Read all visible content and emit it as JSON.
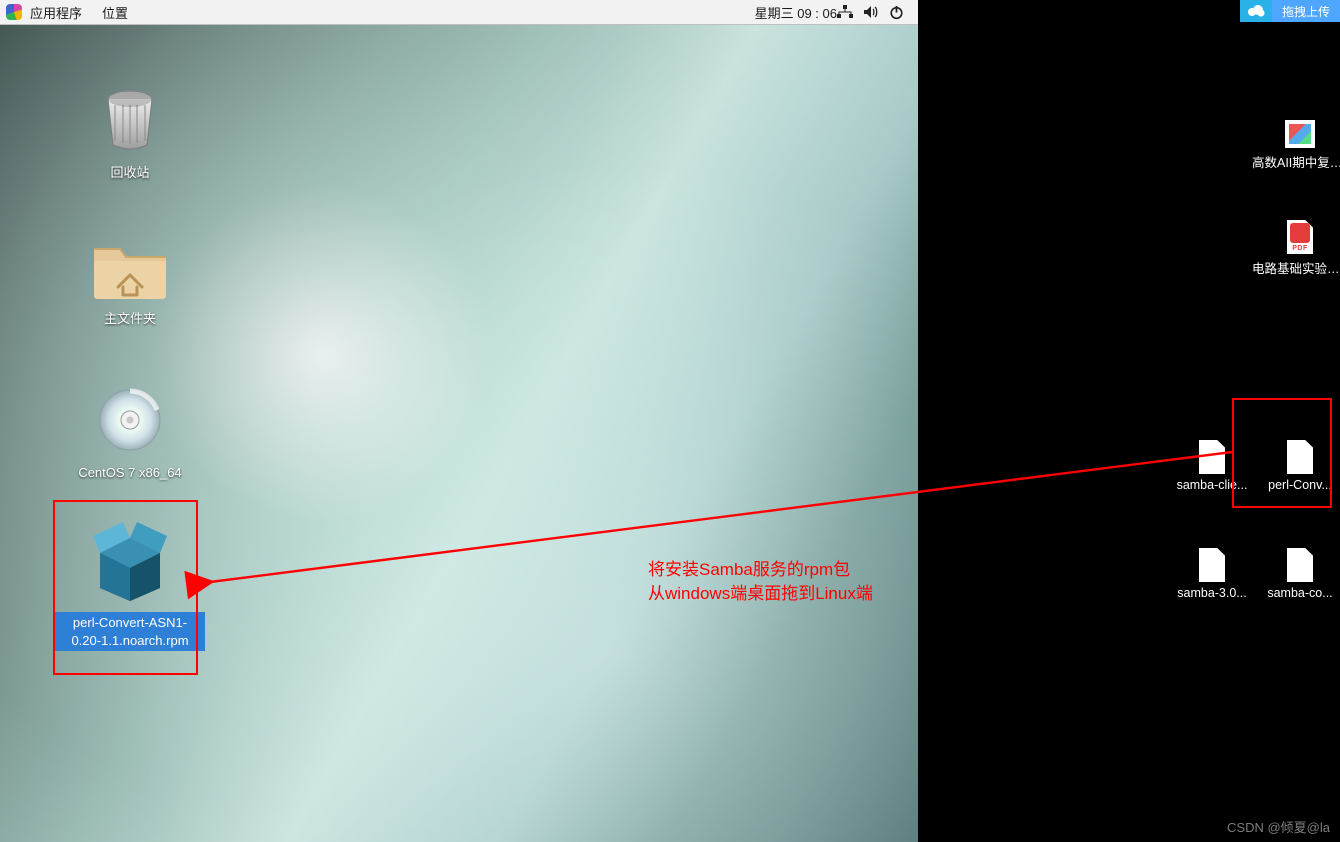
{
  "menubar": {
    "applications": "应用程序",
    "places": "位置",
    "clock": "星期三 09 : 06"
  },
  "tray_icons": {
    "network": "network-icon",
    "volume": "volume-icon",
    "power": "power-icon"
  },
  "linux_desktop": {
    "trash": "回收站",
    "home": "主文件夹",
    "disc": "CentOS 7 x86_64",
    "rpm": "perl-Convert-ASN1-0.20-1.1.noarch.rpm"
  },
  "windows_desktop": {
    "upload_label": "拖拽上传",
    "file1": "高数AII期中复习内容....",
    "file2": "电路基础实验指导书(黄...",
    "file3": "samba-clie...",
    "file4": "perl-Conv...",
    "file5": "samba-3.0...",
    "file6": "samba-co..."
  },
  "annotation": {
    "line1": "将安装Samba服务的rpm包",
    "line2": "从windows端桌面拖到Linux端"
  },
  "watermark": "CSDN @倾夏@la"
}
